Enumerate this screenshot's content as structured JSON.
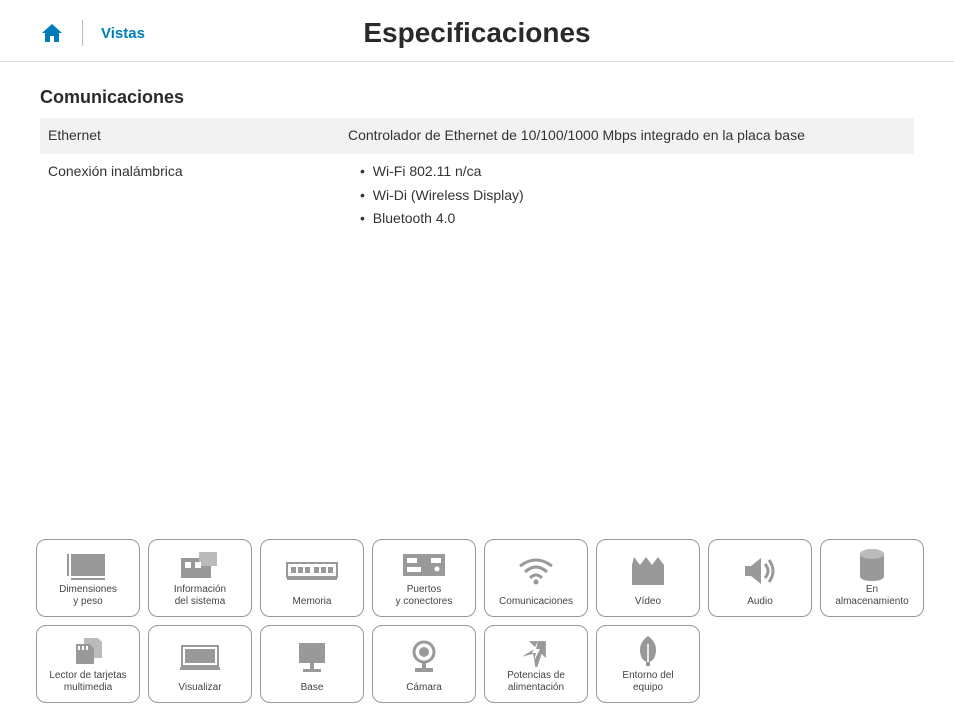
{
  "header": {
    "vistas_label": "Vistas",
    "page_title": "Especificaciones"
  },
  "section": {
    "title": "Comunicaciones",
    "rows": [
      {
        "label": "Ethernet",
        "value": "Controlador de Ethernet de 10/100/1000 Mbps integrado en la placa base"
      },
      {
        "label": "Conexión inalámbrica",
        "bullets": [
          "Wi-Fi 802.11 n/ca",
          "Wi-Di (Wireless Display)",
          "Bluetooth 4.0"
        ]
      }
    ]
  },
  "cards": [
    {
      "label": "Dimensiones\ny peso",
      "icon": "dimensions-icon"
    },
    {
      "label": "Información\ndel sistema",
      "icon": "chip-icon"
    },
    {
      "label": "Memoria",
      "icon": "memory-icon"
    },
    {
      "label": "Puertos\ny conectores",
      "icon": "ports-icon"
    },
    {
      "label": "Comunicaciones",
      "icon": "wifi-icon"
    },
    {
      "label": "Vídeo",
      "icon": "video-icon"
    },
    {
      "label": "Audio",
      "icon": "audio-icon"
    },
    {
      "label": "En\nalmacenamiento",
      "icon": "storage-icon"
    },
    {
      "label": "Lector de tarjetas\nmultimedia",
      "icon": "card-reader-icon"
    },
    {
      "label": "Visualizar",
      "icon": "display-icon"
    },
    {
      "label": "Base",
      "icon": "base-icon"
    },
    {
      "label": "Cámara",
      "icon": "camera-icon"
    },
    {
      "label": "Potencias de\nalimentación",
      "icon": "power-icon"
    },
    {
      "label": "Entorno del\nequipo",
      "icon": "environment-icon"
    }
  ]
}
